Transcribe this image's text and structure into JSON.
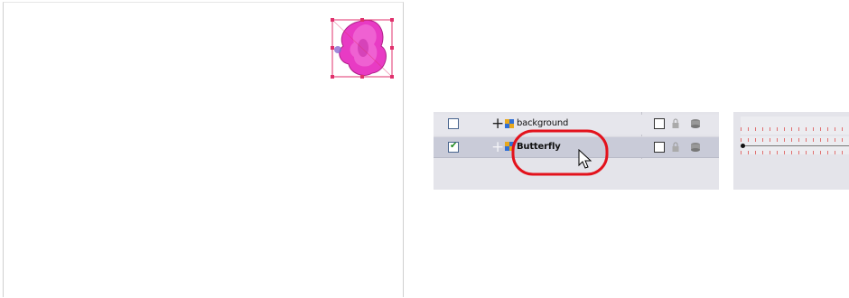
{
  "colors": {
    "selection_handles": "#e0306c",
    "butterfly_fill": "#e83bc4",
    "highlight_circle": "#e3121c",
    "selected_row": "#c9cbd8",
    "checkmark": "#1e8a1e"
  },
  "layers": [
    {
      "name": "background",
      "enabled": false,
      "icons": [
        "add-icon",
        "layer-type-icon",
        "outline-toggle",
        "lock-icon",
        "disk-icon"
      ]
    },
    {
      "name": "Butterfly",
      "enabled": true,
      "selected": true,
      "icons": [
        "add-icon",
        "layer-type-icon",
        "outline-toggle",
        "lock-icon",
        "disk-icon"
      ]
    }
  ],
  "glyphs": {
    "plus": "+",
    "check": "✔"
  }
}
